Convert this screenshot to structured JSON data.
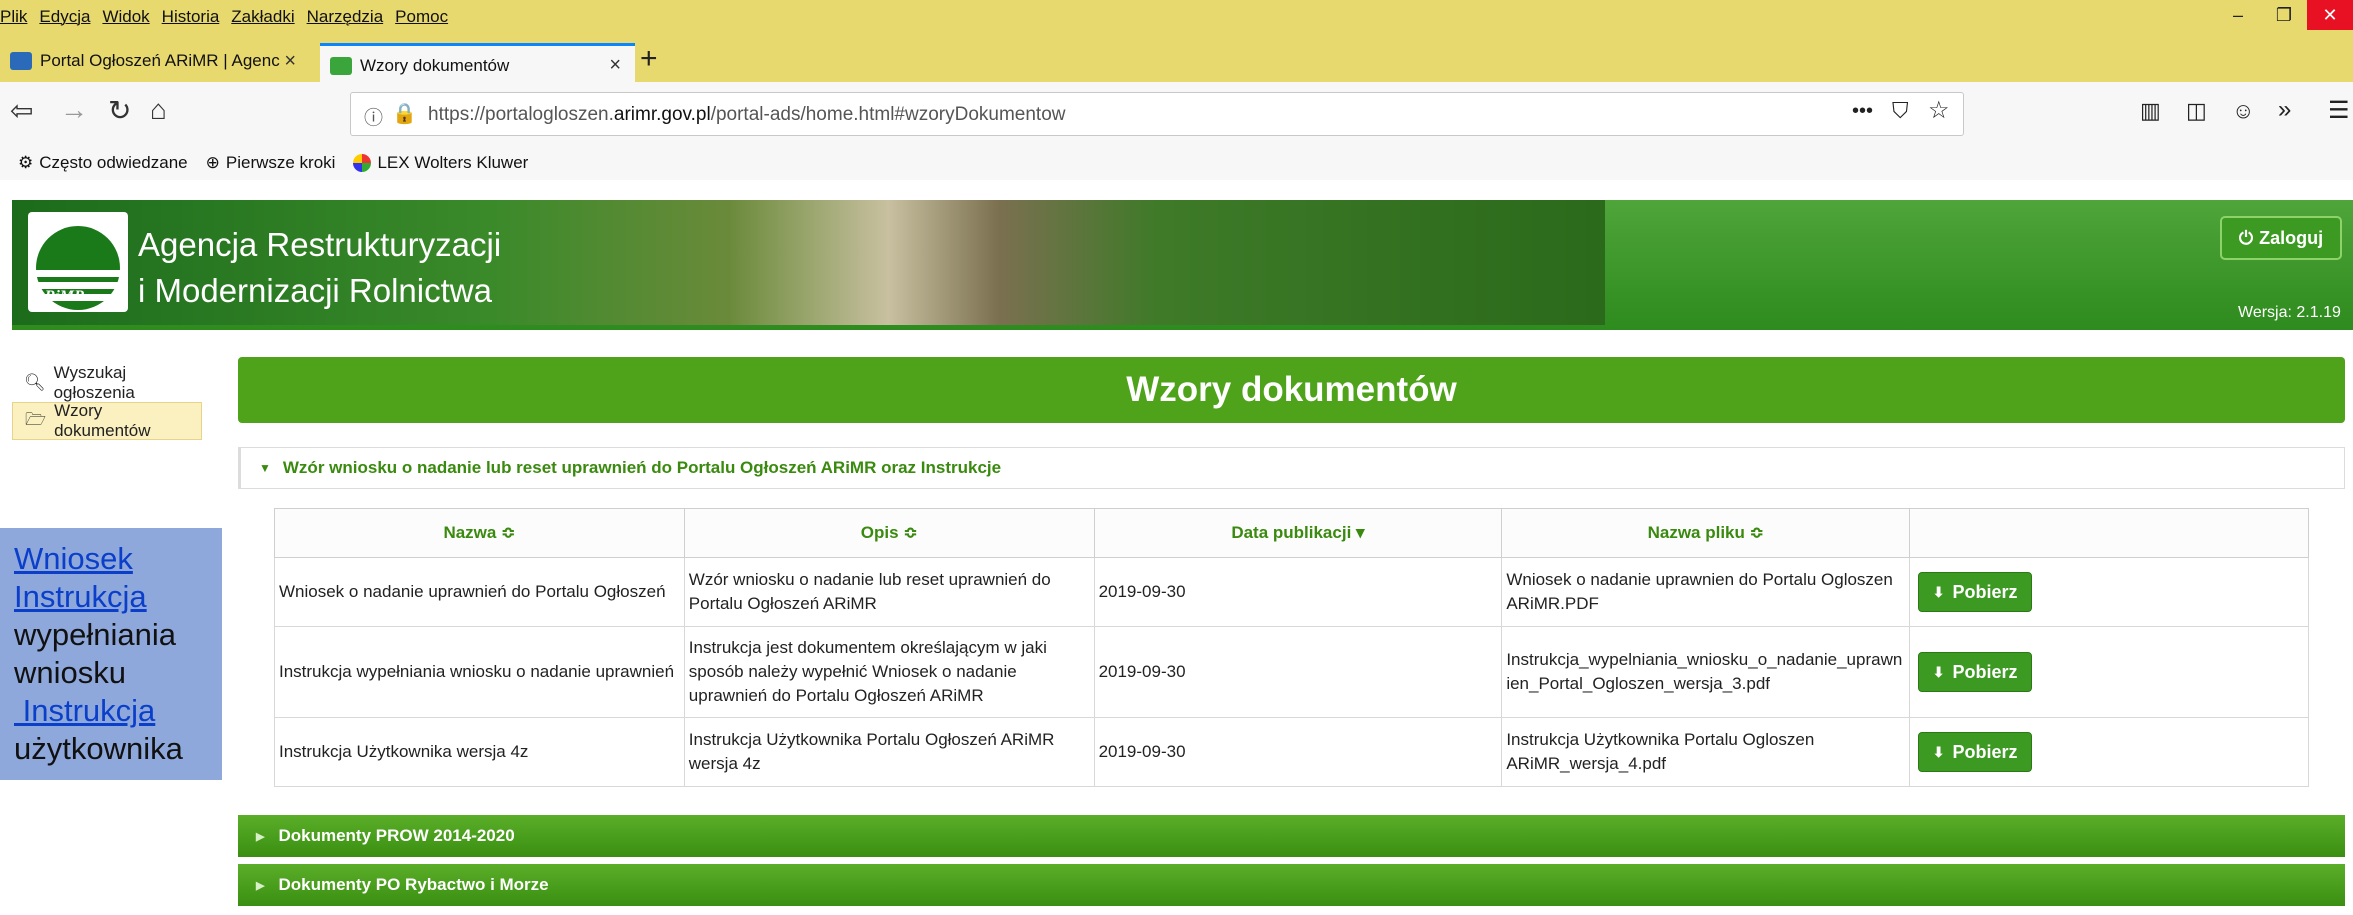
{
  "browser": {
    "menu": [
      "Plik",
      "Edycja",
      "Widok",
      "Historia",
      "Zakładki",
      "Narzędzia",
      "Pomoc"
    ],
    "tabs": [
      {
        "label": "Portal Ogłoszeń ARiMR | Agenc",
        "close": "×"
      },
      {
        "label": "Wzory dokumentów",
        "close": "×"
      }
    ],
    "new_tab": "+",
    "url_prefix": "https://portalogloszen.",
    "url_domain": "arimr.gov.pl",
    "url_path": "/portal-ads/home.html#wzoryDokumentow",
    "bookmarks": [
      "Często odwiedzane",
      "Pierwsze kroki",
      "LEX Wolters Kluwer"
    ]
  },
  "site": {
    "logo_text": "ARiMR",
    "agency_line1": "Agencja Restrukturyzacji",
    "agency_line2": "i Modernizacji Rolnictwa",
    "login_label": "Zaloguj",
    "version": "Wersja: 2.1.19"
  },
  "left_menu": [
    "Wyszukaj ogłoszenia",
    "Wzory dokumentów"
  ],
  "note_box": {
    "link1": "Wniosek",
    "link2": "Instrukcja",
    "text1": "wypełniania",
    "text2": "wniosku",
    "link3": " Instrukcja",
    "text3": "użytkownika"
  },
  "main": {
    "title": "Wzory dokumentów",
    "section1": "Wzór wniosku o nadanie lub reset uprawnień do Portalu Ogłoszeń ARiMR oraz Instrukcje",
    "columns": [
      "Nazwa",
      "Opis",
      "Data publikacji",
      "Nazwa pliku"
    ],
    "sort_icons": [
      "≎",
      "≎",
      "▾",
      "≎"
    ],
    "rows": [
      {
        "nazwa": "Wniosek o nadanie uprawnień do Portalu Ogłoszeń",
        "opis": "Wzór wniosku o nadanie lub reset uprawnień do Portalu Ogłoszeń ARiMR",
        "data": "2019-09-30",
        "plik": "Wniosek o nadanie uprawnien do Portalu Ogloszen ARiMR.PDF",
        "button": "Pobierz"
      },
      {
        "nazwa": "Instrukcja wypełniania wniosku o nadanie uprawnień",
        "opis": "Instrukcja jest dokumentem określającym w jaki sposób należy wypełnić Wniosek o nadanie uprawnień do Portalu Ogłoszeń ARiMR",
        "data": "2019-09-30",
        "plik": "Instrukcja_wypelniania_wniosku_o_nadanie_uprawnien_Portal_Ogloszen_wersja_3.pdf",
        "button": "Pobierz"
      },
      {
        "nazwa": "Instrukcja Użytkownika wersja 4z",
        "opis": "Instrukcja Użytkownika Portalu Ogłoszeń ARiMR wersja 4z",
        "data": "2019-09-30",
        "plik": "Instrukcja Użytkownika Portalu Ogloszen ARiMR_wersja_4.pdf",
        "button": "Pobierz"
      }
    ],
    "section2": "Dokumenty PROW 2014-2020",
    "section3": "Dokumenty PO Rybactwo i Morze"
  },
  "colors": {
    "accent_green": "#4ea31a",
    "titlebar": "#e8d96f",
    "close_red": "#e81123"
  }
}
